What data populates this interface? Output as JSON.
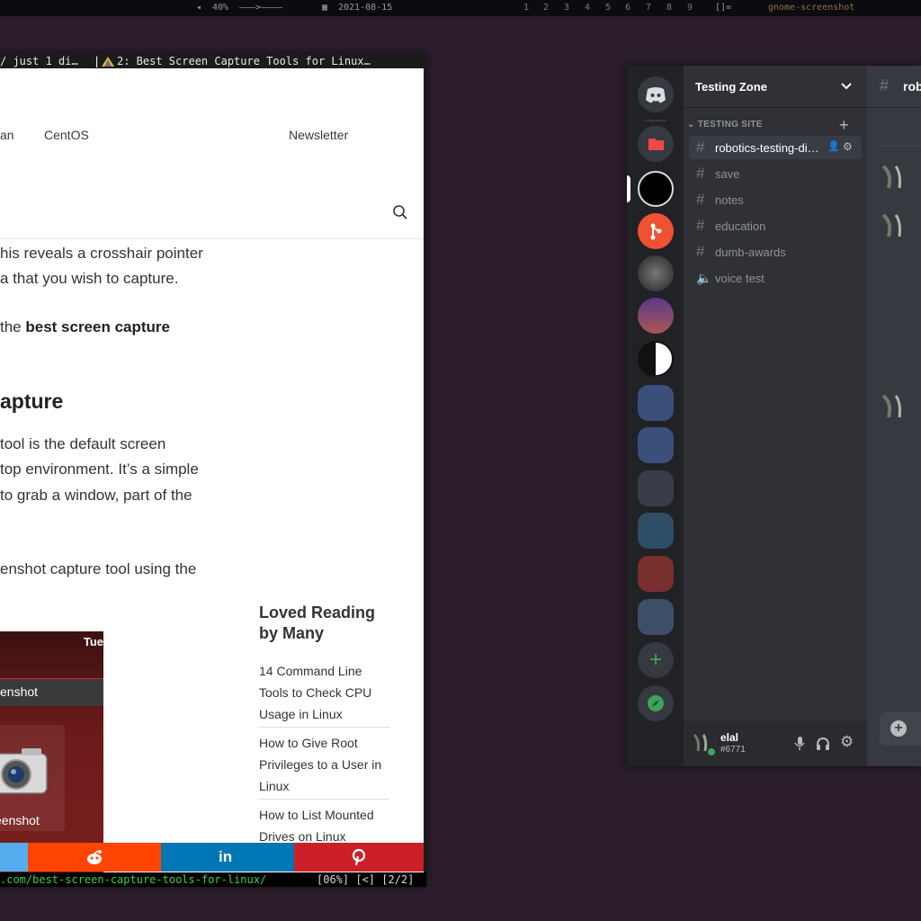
{
  "topbar": {
    "volume": "40%",
    "volume_track": "———>————",
    "date": "2021-08-15",
    "workspaces": [
      "1",
      "2",
      "3",
      "4",
      "5",
      "6",
      "7",
      "8",
      "9"
    ],
    "layout": "[]=",
    "active_window": "gnome-screenshot"
  },
  "browser": {
    "tab1": "/ just 1 di…",
    "tab2": "2: Best Screen Capture Tools for Linux…",
    "nav": [
      "an",
      "CentOS",
      "Newsletter"
    ],
    "paragraphs": {
      "p1": [
        "his reveals a crosshair pointer",
        "a that you wish to capture."
      ],
      "p2_pre": " the ",
      "p2_bold1": "best screen capture",
      "heading": "apture",
      "p3": [
        "tool is the default screen",
        "top environment. It’s a simple",
        "to grab a window, part of the"
      ],
      "p4": "enshot capture tool using the"
    },
    "image": {
      "clock": "Tue",
      "search_text": "enshot",
      "tile_label": "eenshot"
    },
    "sidebar": {
      "heading": "Loved Reading by Many",
      "items": [
        "14 Command Line Tools to Check CPU Usage in Linux",
        "How to Give Root Privileges to a User in Linux",
        "How to List Mounted Drives on Linux"
      ]
    },
    "share": {
      "colors": [
        "#55acee",
        "#ff4500",
        "#0077b5",
        "#cb2027"
      ]
    },
    "status": {
      "url": ".com/best-screen-capture-tools-for-linux/",
      "info": "[06%] [<] [2/2]"
    }
  },
  "discord": {
    "server": "Testing Zone",
    "category": "TESTING SITE",
    "channels": [
      {
        "name": "robotics-testing-di…",
        "type": "text",
        "selected": true
      },
      {
        "name": "save",
        "type": "text"
      },
      {
        "name": "notes",
        "type": "text"
      },
      {
        "name": "education",
        "type": "text"
      },
      {
        "name": "dumb-awards",
        "type": "text"
      },
      {
        "name": "voice test",
        "type": "voice"
      }
    ],
    "chat_header": "rob",
    "user": {
      "name": "elal",
      "tag": "#6771"
    },
    "colors": {
      "accent": "#5865f2",
      "green": "#3ba55c",
      "bg": "#36393f"
    }
  }
}
